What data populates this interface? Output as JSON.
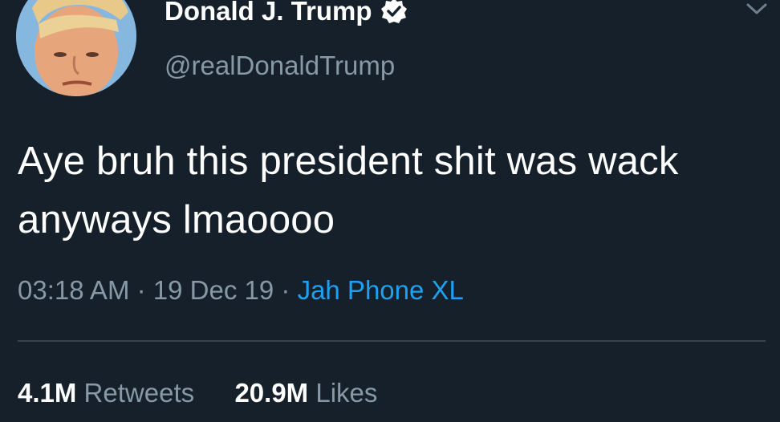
{
  "user": {
    "display_name": "Donald J. Trump",
    "handle": "@realDonaldTrump",
    "verified": true
  },
  "tweet": {
    "text": "Aye bruh this president shit was wack anyways lmaoooo",
    "time": "03:18 AM",
    "separator": "·",
    "date": "19 Dec 19",
    "source": "Jah Phone XL"
  },
  "stats": {
    "retweets_count": "4.1M",
    "retweets_label": "Retweets",
    "likes_count": "20.9M",
    "likes_label": "Likes"
  },
  "colors": {
    "background": "#15202b",
    "secondary_text": "#8899a6",
    "link": "#1da1f2",
    "divider": "#38444d"
  },
  "icons": [
    "verified-badge-icon",
    "chevron-down-icon"
  ]
}
